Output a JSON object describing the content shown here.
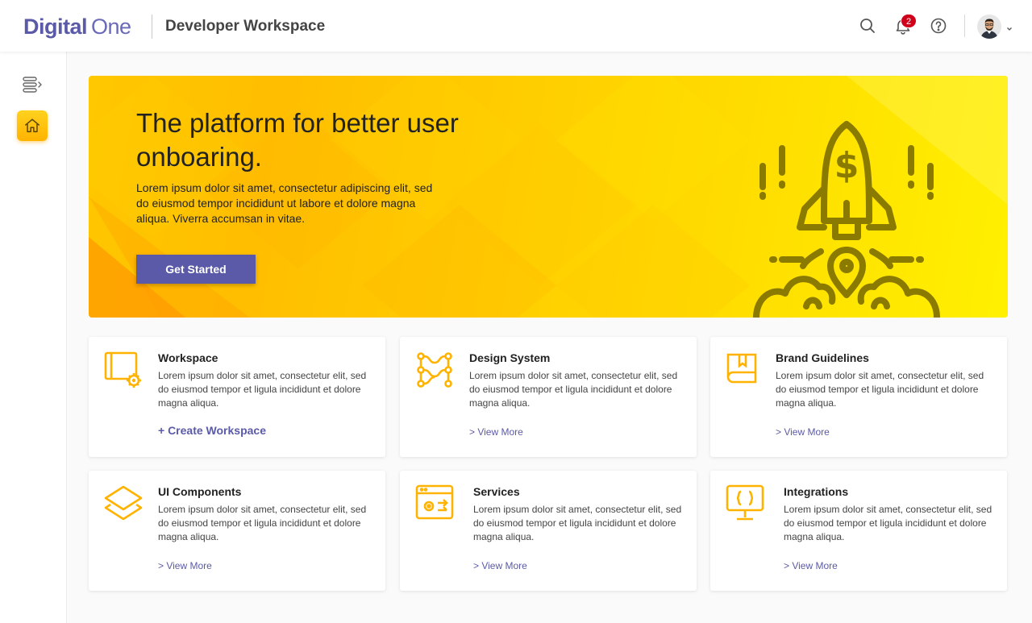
{
  "header": {
    "logo_part1": "Digital",
    "logo_part2": "One",
    "title": "Developer Workspace",
    "notifications_count": "2",
    "icons": [
      "search-icon",
      "bell-icon",
      "help-icon",
      "avatar",
      "chevron-down-icon"
    ]
  },
  "sidebar": {
    "items": [
      {
        "name": "menu-toggle",
        "icon": "menu-expand-icon"
      },
      {
        "name": "home",
        "icon": "home-icon",
        "active": true
      }
    ]
  },
  "hero": {
    "title": "The platform for better user onboaring.",
    "text": "Lorem ipsum dolor sit amet, consectetur adipiscing elit, sed do eiusmod tempor incididunt ut labore et dolore magna aliqua. Viverra accumsan in vitae.",
    "button": "Get Started",
    "illustration": "rocket-icon"
  },
  "cards": [
    {
      "title": "Workspace",
      "desc": "Lorem ipsum dolor sit amet, consectetur elit, sed do eiusmod tempor et ligula incididunt et dolore magna aliqua.",
      "link": "+ Create Workspace",
      "icon": "workspace-icon"
    },
    {
      "title": "Design System",
      "desc": "Lorem ipsum dolor sit amet, consectetur elit, sed do eiusmod tempor et ligula incididunt et dolore magna aliqua.",
      "link": "> View More",
      "icon": "design-system-icon"
    },
    {
      "title": "Brand Guidelines",
      "desc": "Lorem ipsum dolor sit amet, consectetur elit, sed do eiusmod tempor et ligula incididunt et dolore magna aliqua.",
      "link": "> View More",
      "icon": "book-icon"
    },
    {
      "title": "UI Components",
      "desc": "Lorem ipsum dolor sit amet, consectetur elit, sed do eiusmod tempor et ligula incididunt et dolore magna aliqua.",
      "link": "> View More",
      "icon": "layers-icon"
    },
    {
      "title": "Services",
      "desc": "Lorem ipsum dolor sit amet, consectetur elit, sed do eiusmod tempor et ligula incididunt et dolore magna aliqua.",
      "link": "> View More",
      "icon": "services-icon"
    },
    {
      "title": "Integrations",
      "desc": "Lorem ipsum dolor sit amet, consectetur elit, sed do eiusmod tempor et ligula incididunt et dolore magna aliqua.",
      "link": "> View More",
      "icon": "code-monitor-icon"
    }
  ],
  "colors": {
    "brand": "#5b5aa8",
    "accent": "#ffb300",
    "badge": "#d0021b",
    "rocket": "#8a7a00"
  }
}
